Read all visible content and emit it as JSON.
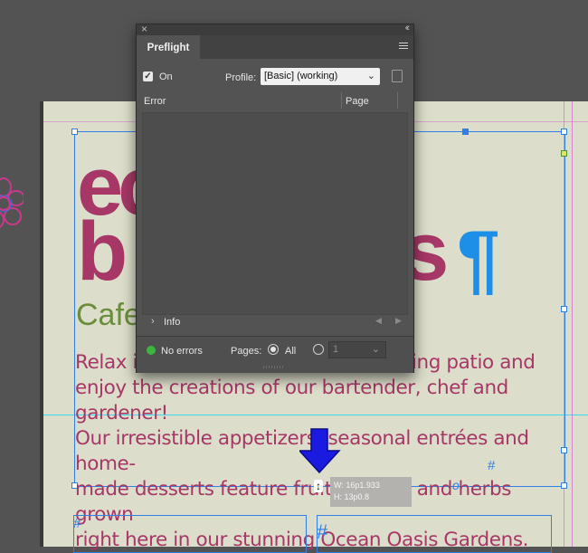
{
  "document": {
    "headline_line1": "ec",
    "headline_line2": "b",
    "headline_line2_tail": "as",
    "pilcrow": "¶",
    "subtitle": "Cafe",
    "body_lines": [
      "Relax in",
      "g",
      "harming patio and",
      "enjoy the creations of our bartender, chef and gardener!",
      "Our irresistible appetizers, seasonal entrées and home-",
      "made desserts feature fruit, flowers and herbs grown",
      "right here in our stunning Ocean Oasis Gardens."
    ],
    "hash_marks": [
      "#",
      "#",
      "#"
    ],
    "overset_marker": "o"
  },
  "panel": {
    "title": "Preflight",
    "close_symbol": "×",
    "collapse_symbol": "‹‹",
    "on_checked": true,
    "on_label": "On",
    "profile_label": "Profile:",
    "profile_value": "[Basic] (working)",
    "columns": [
      "Error",
      "Page"
    ],
    "info_label": "Info",
    "status_text": "No errors",
    "pages_label": "Pages:",
    "all_label": "All",
    "all_selected": true,
    "page_field_value": "1",
    "colors": {
      "status_ok": "#3db43b",
      "panel_bg": "#535353"
    }
  },
  "tooltip": {
    "width_text": "W: 16p1.933",
    "height_text": "H: 13p0.8"
  }
}
